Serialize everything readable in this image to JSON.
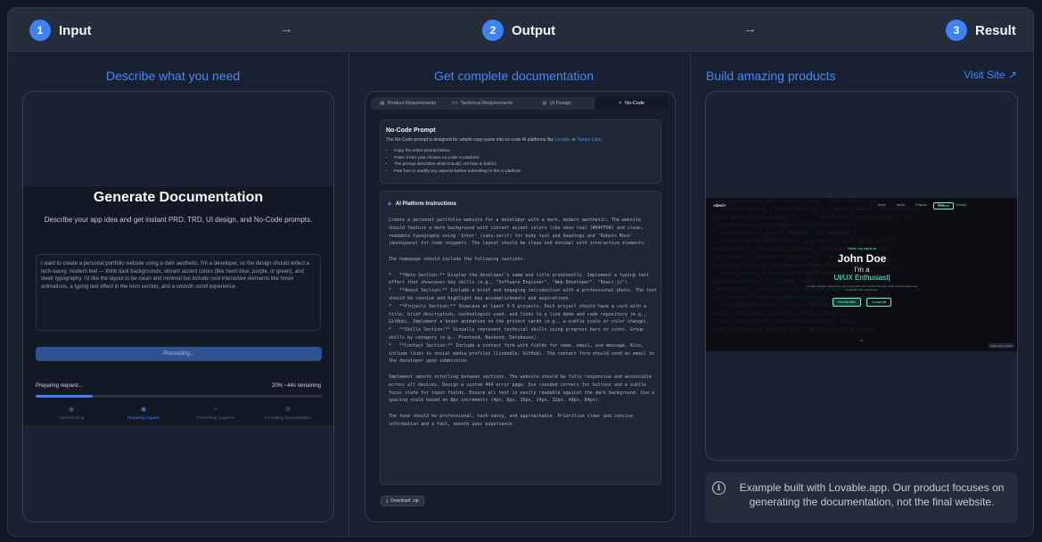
{
  "steps": [
    {
      "num": "1",
      "label": "Input"
    },
    {
      "num": "2",
      "label": "Output"
    },
    {
      "num": "3",
      "label": "Result"
    }
  ],
  "arrow_glyph": "→",
  "input": {
    "heading": "Describe what you need",
    "title": "Generate Documentation",
    "subtitle": "Describe your app idea and get instant PRD, TRD, UI design, and No-Code prompts.",
    "prompt_text": "I want to create a personal portfolio website using a dark aesthetic. I'm a developer, so the design should reflect a tech-savvy, modern feel — think dark backgrounds, vibrant accent colors (like neon blue, purple, or green), and sleek typography. I'd like the layout to be clean and minimal but include cool interactive elements like hover animations, a typing text effect in the hero section, and a smooth scroll experience.",
    "button_label": "Processing...",
    "status_label": "Preparing request...",
    "progress_text": "20%  ~44s remaining",
    "progress_value": 0.2,
    "phases": [
      {
        "icon": "◉",
        "label": "Authenticating"
      },
      {
        "icon": "◉",
        "label": "Preparing request"
      },
      {
        "icon": "✧",
        "label": "Processing response"
      },
      {
        "icon": "⚙",
        "label": "Formatting documentation"
      }
    ]
  },
  "output": {
    "heading": "Get complete documentation",
    "tabs": [
      {
        "icon": "▤",
        "label": "Product Requirements"
      },
      {
        "icon": "<>",
        "label": "Technical Requirements"
      },
      {
        "icon": "◍",
        "label": "UI Design"
      },
      {
        "icon": "✧",
        "label": "No-Code"
      }
    ],
    "nocode_title": "No-Code Prompt",
    "nocode_desc": "The No-Code prompt is designed for simple copy-paste into no-code AI platforms like",
    "nocode_link1": "Lovable",
    "nocode_or": "or",
    "nocode_link2": "Tempo Labs",
    "nocode_bullets": [
      "Copy the entire prompt below",
      "Paste it into your chosen no-code AI platform",
      "The prompt describes what to build, not how to build it",
      "Feel free to modify any aspects before submitting to the AI platform"
    ],
    "ai_title": "AI Platform Instructions",
    "ai_body": "Create a personal portfolio website for a developer with a dark, modern aesthetic. The website should feature a dark background with vibrant accent colors like neon teal (#64FFDA) and clean, readable typography using 'Inter' (sans-serif) for body text and headings and 'Roboto Mono' (monospace) for code snippets. The layout should be clean and minimal with interactive elements.\n\nThe homepage should include the following sections:\n\n*   **Hero Section:** Display the developer's name and title prominently. Implement a typing text effect that showcases key skills (e.g., \"Software Engineer\", \"Web Developer\", \"React.js\").\n*   **About Section:** Include a brief and engaging introduction with a professional photo. The text should be concise and highlight key accomplishments and aspirations.\n*   **Projects Section:** Showcase at least 3-5 projects. Each project should have a card with a title, brief description, technologies used, and links to a live demo and code repository (e.g., GitHub). Implement a hover animation on the project cards (e.g., a subtle scale or color change).\n*   **Skills Section:** Visually represent technical skills using progress bars or icons. Group skills by category (e.g., Frontend, Backend, Databases).\n*   **Contact Section:** Include a contact form with fields for name, email, and message. Also, include links to social media profiles (LinkedIn, GitHub). The contact form should send an email to the developer upon submission.\n\nImplement smooth scrolling between sections. The website should be fully responsive and accessible across all devices. Design a custom 404 error page. Use rounded corners for buttons and a subtle focus state for input fields. Ensure all text is easily readable against the dark background. Use a spacing scale based on 8px increments (4px, 8px, 16px, 24px, 32px, 48px, 64px).\n\nThe tone should be professional, tech-savvy, and approachable. Prioritize clear and concise information and a fast, smooth user experience.",
    "download_label": "Download .zip"
  },
  "result": {
    "heading": "Build amazing products",
    "visit_label": "Visit Site",
    "site": {
      "logo": "<dev/>",
      "nav": [
        "Home",
        "About",
        "Projects",
        "Skills",
        "Contact"
      ],
      "nav_button": "Resume",
      "hello": "Hello, my name is",
      "name": "John Doe",
      "role_prefix": "I'm a",
      "role_typed": "UI/UX Enthusiast|",
      "desc": "Creating elegant, performant, and accessible web experiences with modern technologies and thoughtful user interactions.",
      "buttons": [
        "View My Work",
        "Contact Me"
      ],
      "badge": "Made with Lovable"
    },
    "note": "Example built with Lovable.app. Our product focuses on generating the documentation, not the final website."
  },
  "colors": {
    "accent": "#3f82f6",
    "neon_teal": "#64FFDA"
  }
}
